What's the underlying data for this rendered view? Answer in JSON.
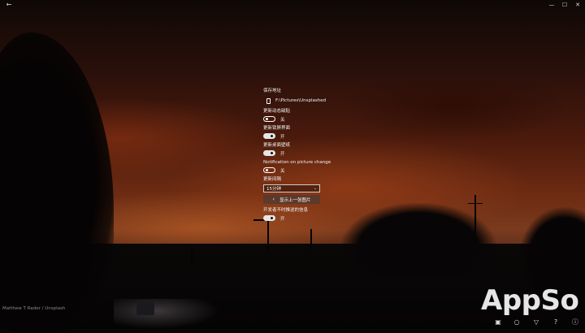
{
  "window": {
    "back_glyph": "←",
    "minimize_glyph": "—",
    "maximize_glyph": "☐",
    "close_glyph": "✕"
  },
  "settings": {
    "save_location": {
      "label": "保存地址",
      "path": "F:\\Pictures\\Unsplashed",
      "icon": "folder-icon"
    },
    "toggles": [
      {
        "key": "live_tile",
        "label": "更新动态磁贴",
        "state": "关",
        "on": false
      },
      {
        "key": "lock_screen",
        "label": "更新锁屏界面",
        "state": "开",
        "on": true
      },
      {
        "key": "wallpaper",
        "label": "更新桌面壁纸",
        "state": "开",
        "on": true
      },
      {
        "key": "notification",
        "label": "Notification on picture change",
        "state": "关",
        "on": false
      }
    ],
    "interval": {
      "label": "更新间隔",
      "value": "15分钟"
    },
    "prev_button": {
      "label": "显示上一张图片"
    },
    "dev_messages": {
      "label": "开发者不时推送的信息",
      "state": "开",
      "on": true
    }
  },
  "photo_credit": "Matthew T Rader / Unsplash",
  "watermark": "AppSo",
  "bottom_bar": {
    "icons": [
      "save-icon",
      "circle-icon",
      "filter-icon",
      "help-icon",
      "info-icon"
    ],
    "glyphs": [
      "▣",
      "○",
      "▽",
      "?",
      "ⓘ"
    ]
  }
}
